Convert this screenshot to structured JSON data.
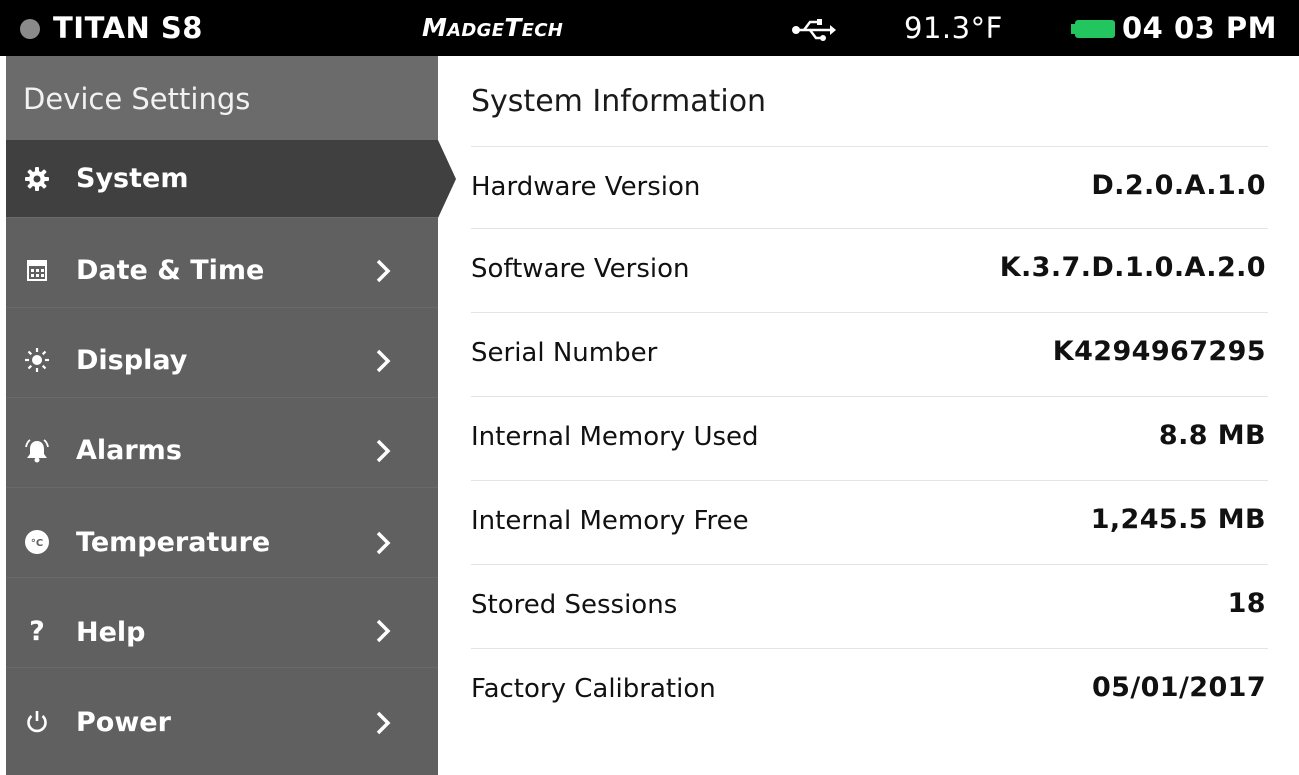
{
  "statusbar": {
    "device_name": "TITAN S8",
    "brand": "MadgeTech",
    "usb_icon": "usb-icon",
    "temperature": "91.3°F",
    "battery_color": "#22c55e",
    "time": "04 03 PM"
  },
  "sidebar": {
    "title": "Device Settings",
    "items": [
      {
        "label": "System",
        "icon": "gear-icon",
        "active": true
      },
      {
        "label": "Date & Time",
        "icon": "calendar-icon"
      },
      {
        "label": "Display",
        "icon": "brightness-icon"
      },
      {
        "label": "Alarms",
        "icon": "bell-icon"
      },
      {
        "label": "Temperature",
        "icon": "celsius-icon"
      },
      {
        "label": "Help",
        "icon": "question-icon"
      },
      {
        "label": "Power",
        "icon": "power-icon"
      }
    ]
  },
  "main": {
    "title": "System Information",
    "rows": [
      {
        "key": "Hardware Version",
        "value": "D.2.0.A.1.0"
      },
      {
        "key": "Software Version",
        "value": "K.3.7.D.1.0.A.2.0"
      },
      {
        "key": "Serial Number",
        "value": "K4294967295"
      },
      {
        "key": "Internal Memory Used",
        "value": "8.8 MB"
      },
      {
        "key": "Internal Memory Free",
        "value": "1,245.5 MB"
      },
      {
        "key": "Stored Sessions",
        "value": "18"
      },
      {
        "key": "Factory Calibration",
        "value": "05/01/2017"
      }
    ]
  }
}
